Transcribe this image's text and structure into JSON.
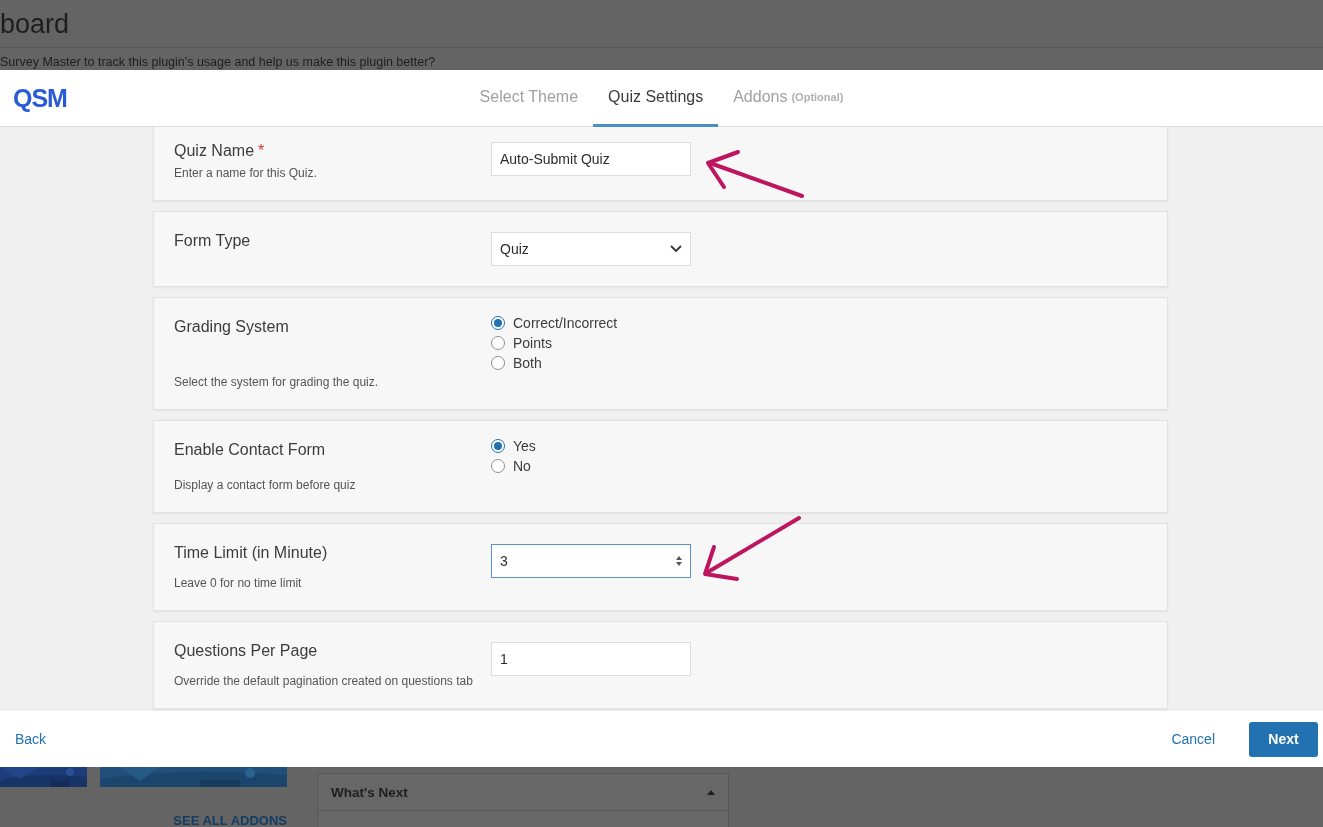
{
  "background": {
    "page_title": "board",
    "notice": "Survey Master to track this plugin's usage and help us make this plugin better?",
    "addons_link": "SEE ALL ADDONS",
    "panel_title": "What's Next"
  },
  "modal": {
    "logo": "QSM",
    "tabs": [
      {
        "label": "Select Theme",
        "selected": false
      },
      {
        "label": "Quiz Settings",
        "selected": true
      },
      {
        "label": "Addons",
        "note": "(Optional)",
        "selected": false
      }
    ],
    "settings": [
      {
        "kind": "text",
        "label": "Quiz Name",
        "required_mark": "*",
        "description": "Enter a name for this Quiz.",
        "value": "Auto-Submit Quiz"
      },
      {
        "kind": "select",
        "label": "Form Type",
        "value": "Quiz"
      },
      {
        "kind": "radio",
        "label": "Grading System",
        "description": "Select the system for grading the quiz.",
        "options": [
          {
            "label": "Correct/Incorrect",
            "selected": true
          },
          {
            "label": "Points",
            "selected": false
          },
          {
            "label": "Both",
            "selected": false
          }
        ]
      },
      {
        "kind": "radio",
        "label": "Enable Contact Form",
        "description": "Display a contact form before quiz",
        "options": [
          {
            "label": "Yes",
            "selected": true
          },
          {
            "label": "No",
            "selected": false
          }
        ]
      },
      {
        "kind": "number",
        "label": "Time Limit (in Minute)",
        "description": "Leave 0 for no time limit",
        "value": "3",
        "focused": true
      },
      {
        "kind": "text",
        "label": "Questions Per Page",
        "description": "Override the default pagination created on questions tab",
        "value": "1"
      }
    ],
    "footer": {
      "back": "Back",
      "cancel": "Cancel",
      "next": "Next"
    }
  }
}
